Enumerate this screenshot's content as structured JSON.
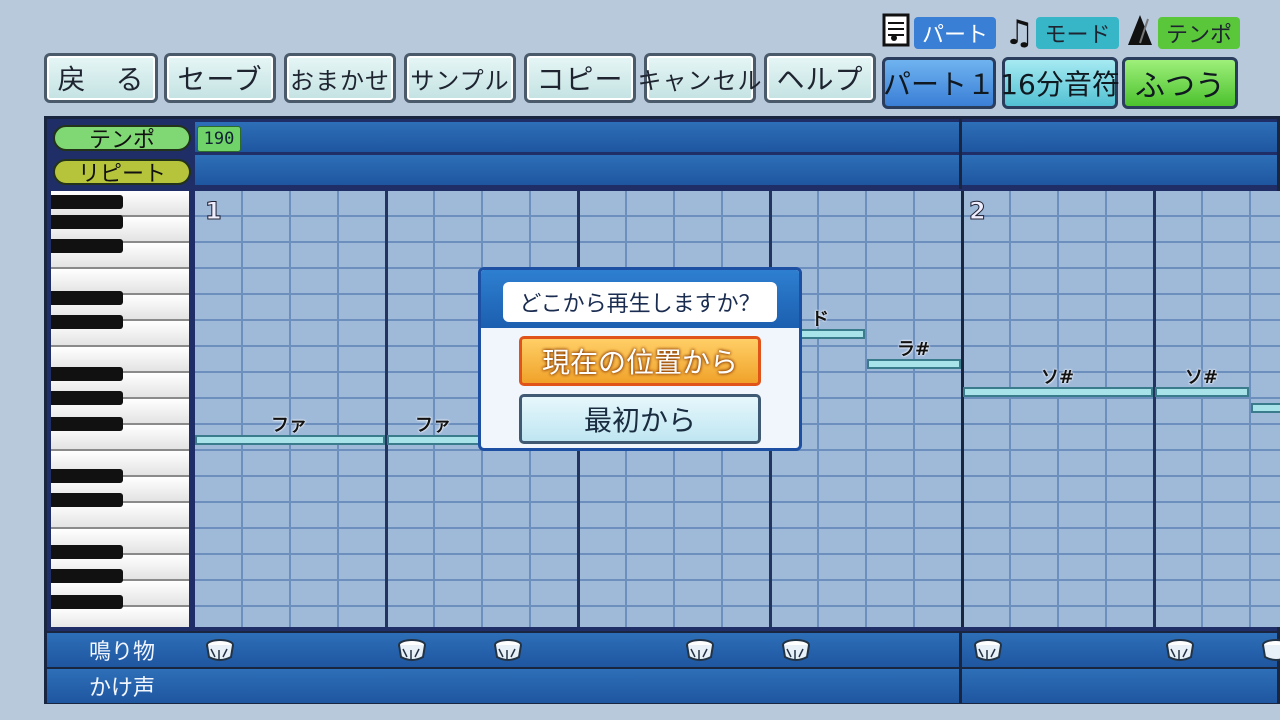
{
  "toolbar": {
    "back": "戻　る",
    "save": "セーブ",
    "auto": "おまかせ",
    "sample": "サンプル",
    "copy": "コピー",
    "cancel": "キャンセル",
    "help": "ヘルプ"
  },
  "selectors": {
    "part": {
      "label": "パート",
      "value": "パート１",
      "color": "#3a7fd6"
    },
    "mode": {
      "label": "モード",
      "value": "16分音符",
      "color": "#37b6c8"
    },
    "tempo": {
      "label": "テンポ",
      "value": "ふつう",
      "color": "#5ac63a"
    }
  },
  "editor": {
    "tempo_label": "テンポ",
    "tempo_value": "190",
    "repeat_label": "リピート",
    "measure1": "1",
    "measure2": "2",
    "notes": [
      {
        "label": "ファ"
      },
      {
        "label": "ファ"
      },
      {
        "label": "ド"
      },
      {
        "label": "ラ#"
      },
      {
        "label": "ソ#"
      },
      {
        "label": "ソ#"
      }
    ],
    "percussion_label": "鳴り物",
    "voice_label": "かけ声"
  },
  "dialog": {
    "title": "どこから再生しますか？",
    "option_current": "現在の位置から",
    "option_first": "最初から"
  }
}
